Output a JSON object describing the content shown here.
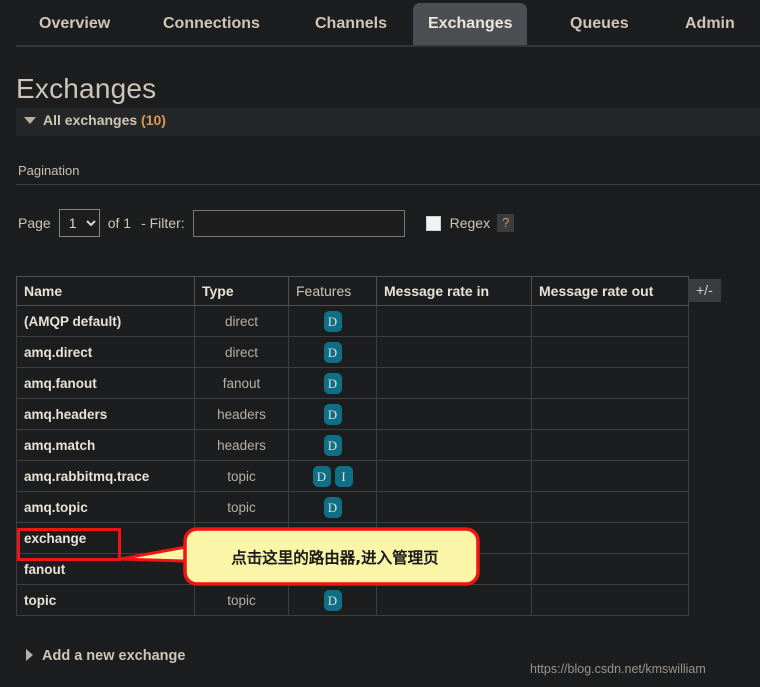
{
  "nav": {
    "tabs": [
      {
        "label": "Overview",
        "active": false
      },
      {
        "label": "Connections",
        "active": false
      },
      {
        "label": "Channels",
        "active": false
      },
      {
        "label": "Exchanges",
        "active": true
      },
      {
        "label": "Queues",
        "active": false
      },
      {
        "label": "Admin",
        "active": false
      }
    ]
  },
  "page": {
    "title": "Exchanges",
    "section_label": "All exchanges",
    "section_count": "(10)"
  },
  "pagination": {
    "heading": "Pagination",
    "page_label": "Page",
    "page_value": "1",
    "page_options": [
      "1"
    ],
    "of_text": "of 1",
    "filter_prefix": "- Filter:",
    "filter_value": "",
    "filter_placeholder": "",
    "regex_label": "Regex",
    "regex_help": "?",
    "regex_checked": false
  },
  "table": {
    "columns": [
      "Name",
      "Type",
      "Features",
      "Message rate in",
      "Message rate out"
    ],
    "toggle_columns_label": "+/-",
    "rows": [
      {
        "name": "(AMQP default)",
        "type": "direct",
        "features": [
          "D"
        ],
        "rate_in": "",
        "rate_out": ""
      },
      {
        "name": "amq.direct",
        "type": "direct",
        "features": [
          "D"
        ],
        "rate_in": "",
        "rate_out": ""
      },
      {
        "name": "amq.fanout",
        "type": "fanout",
        "features": [
          "D"
        ],
        "rate_in": "",
        "rate_out": ""
      },
      {
        "name": "amq.headers",
        "type": "headers",
        "features": [
          "D"
        ],
        "rate_in": "",
        "rate_out": ""
      },
      {
        "name": "amq.match",
        "type": "headers",
        "features": [
          "D"
        ],
        "rate_in": "",
        "rate_out": ""
      },
      {
        "name": "amq.rabbitmq.trace",
        "type": "topic",
        "features": [
          "D",
          "I"
        ],
        "rate_in": "",
        "rate_out": ""
      },
      {
        "name": "amq.topic",
        "type": "topic",
        "features": [
          "D"
        ],
        "rate_in": "",
        "rate_out": ""
      },
      {
        "name": "exchange",
        "type": "",
        "features": [],
        "rate_in": "",
        "rate_out": ""
      },
      {
        "name": "fanout",
        "type": "",
        "features": [],
        "rate_in": "",
        "rate_out": ""
      },
      {
        "name": "topic",
        "type": "topic",
        "features": [
          "D"
        ],
        "rate_in": "",
        "rate_out": ""
      }
    ]
  },
  "footer": {
    "add_new_label": "Add a new exchange",
    "watermark": "https://blog.csdn.net/kmswilliam"
  },
  "annotation": {
    "callout_text": "点击这里的路由器,进入管理页",
    "highlight_target": "exchange",
    "box_color": "#f01414",
    "bubble_fill": "#fbf5a8",
    "bubble_stroke": "#f01414"
  },
  "colors": {
    "background": "#1c1d1f",
    "badge": "#0f6f87",
    "accent_orange": "#d89a5a",
    "active_tab": "#4b4f53"
  }
}
